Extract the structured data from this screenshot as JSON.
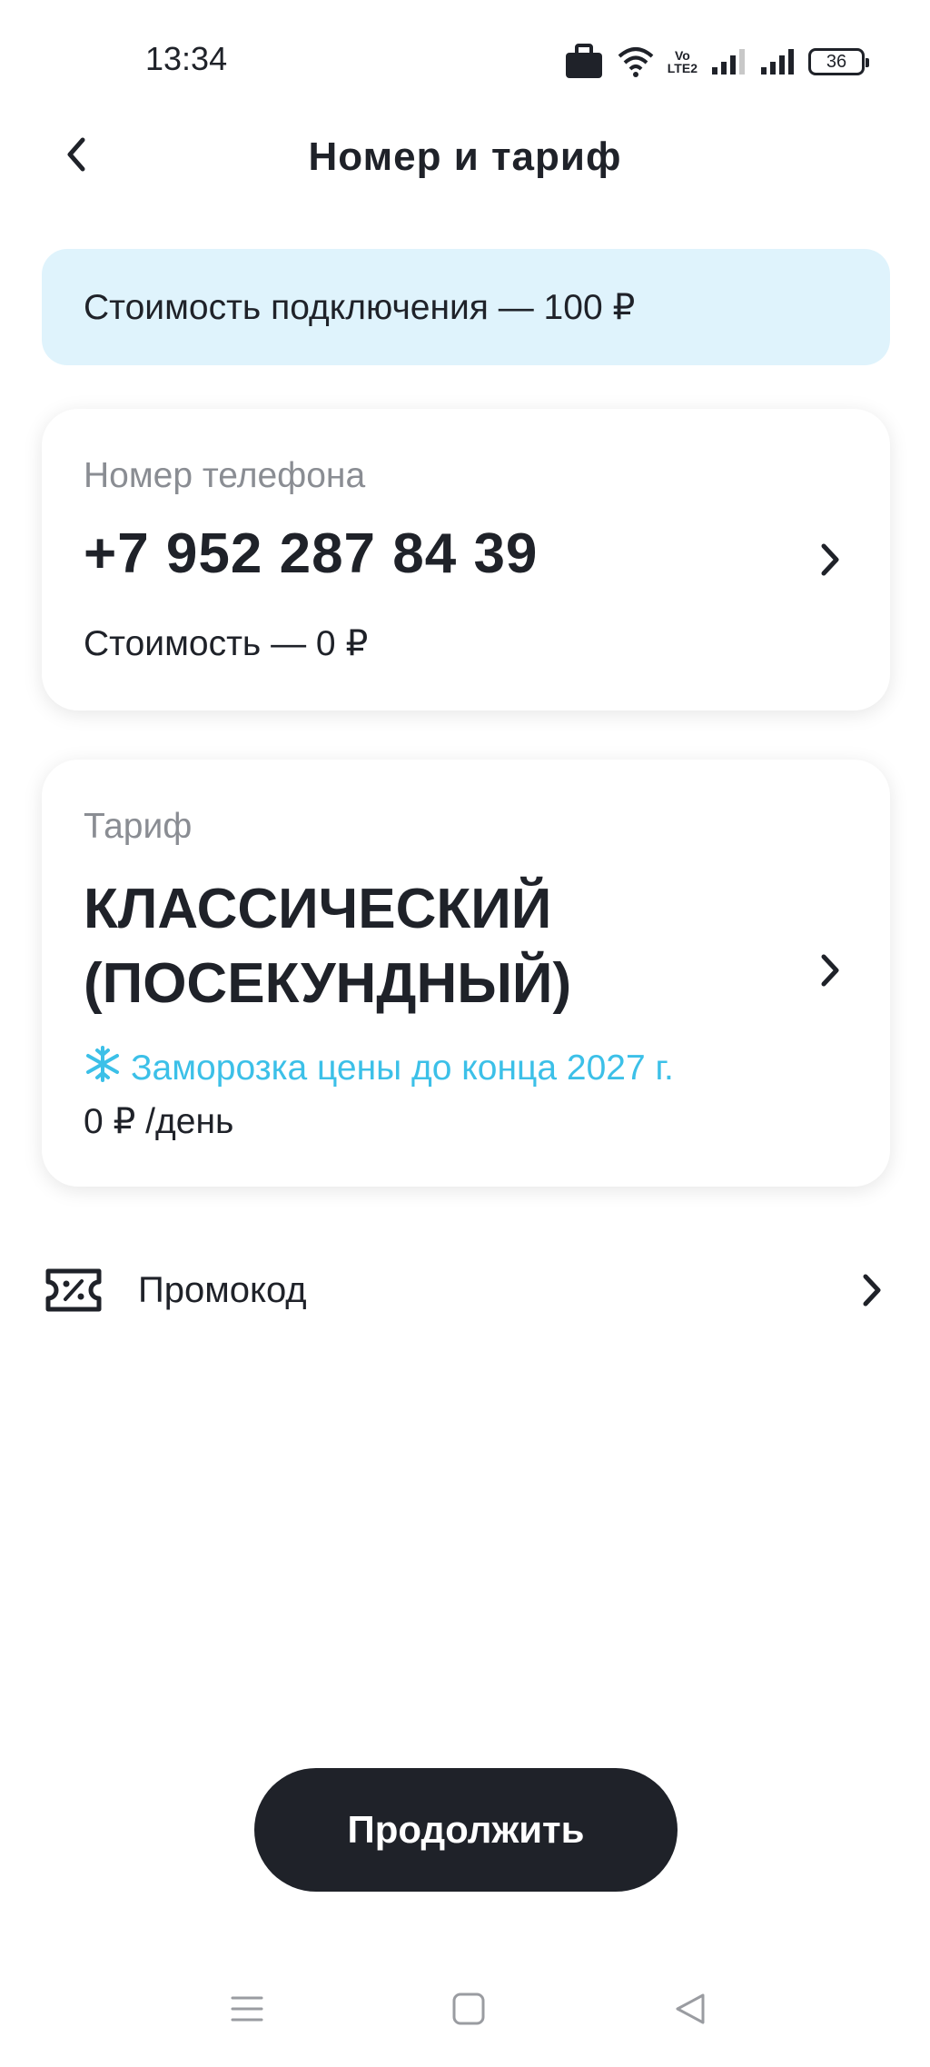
{
  "status_bar": {
    "time": "13:34",
    "volte_top": "Vo",
    "volte_bottom": "LTE2",
    "battery": "36",
    "icons": [
      "briefcase-icon",
      "wifi-icon",
      "volte-icon",
      "signal-icon",
      "signal-icon",
      "battery-icon"
    ]
  },
  "header": {
    "title": "Номер и тариф",
    "back_icon": "chevron-left-icon"
  },
  "banner": {
    "text": "Стоимость подключения — 100 ₽",
    "color": "#dff3fc"
  },
  "phone_card": {
    "label": "Номер телефона",
    "number": "+7 952 287 84 39",
    "cost": "Стоимость — 0 ₽"
  },
  "tariff_card": {
    "label": "Тариф",
    "name": "КЛАССИЧЕСКИЙ (ПОСЕКУНДНЫЙ)",
    "freeze_text": "Заморозка цены до конца 2027 г.",
    "freeze_icon": "snowflake-icon",
    "freeze_color": "#3cc0e8",
    "price": "0 ₽ /день"
  },
  "promo": {
    "label": "Промокод",
    "icon": "coupon-percent-icon"
  },
  "actions": {
    "continue_label": "Продолжить",
    "button_color": "#1f2229"
  },
  "system_nav": {
    "icons": [
      "menu-icon",
      "home-icon",
      "back-triangle-icon"
    ]
  }
}
